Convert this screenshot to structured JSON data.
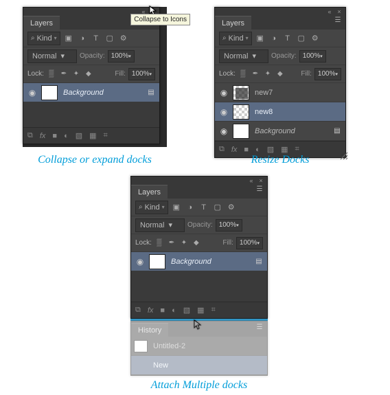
{
  "captions": {
    "collapse": "Collapse or expand docks",
    "resize": "Resize Docks",
    "attach": "Attach Multiple docks"
  },
  "common": {
    "tab_layers": "Layers",
    "tab_history": "History",
    "kind": "Kind",
    "blend_normal": "Normal",
    "opacity_label": "Opacity:",
    "fill_label": "Fill:",
    "lock_label": "Lock:",
    "pct100": "100%",
    "layer_bg": "Background",
    "layer_new7": "new7",
    "layer_new8": "new8",
    "history_doc": "Untitled-2",
    "history_step": "New",
    "tooltip_collapse": "Collapse to Icons"
  },
  "icons": {
    "collapse": "«",
    "close": "×",
    "menu": "☰",
    "search": "⌕",
    "chev": "▾",
    "img": "▣",
    "adjust": "◑",
    "text": "T",
    "shape": "▢",
    "fx_sm": "⚙",
    "eye": "◉",
    "lock_pix": "▒",
    "lock_brush": "✒",
    "lock_move": "✦",
    "lock_all": "◆",
    "lockpad": "▤",
    "link": "⧉",
    "fx": "fx",
    "mask": "■",
    "adjust2": "◐",
    "folder": "▧",
    "newlayer": "▦",
    "trash": "⌗"
  }
}
